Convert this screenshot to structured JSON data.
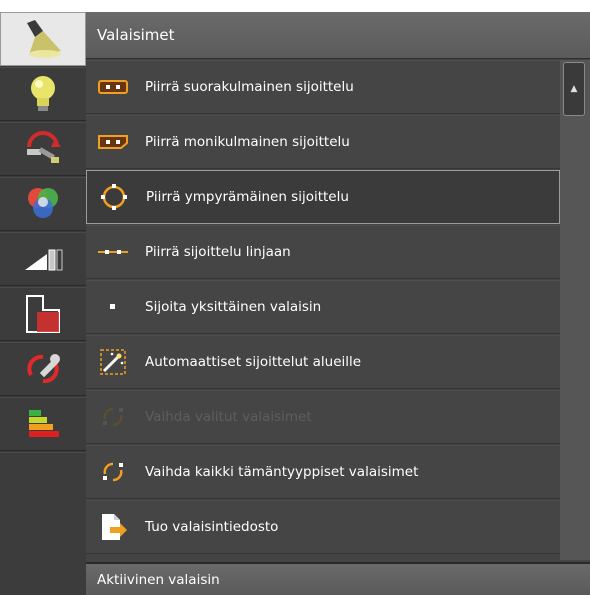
{
  "panel": {
    "title": "Valaisimet",
    "footer_title": "Aktiivinen valaisin"
  },
  "toolbar": {
    "tools": [
      {
        "name": "spotlight-icon",
        "active": true
      },
      {
        "name": "light-bulb-icon"
      },
      {
        "name": "lamp-adjust-icon"
      },
      {
        "name": "color-mix-icon"
      },
      {
        "name": "ramp-icon"
      },
      {
        "name": "room-area-icon"
      },
      {
        "name": "replace-tools-icon"
      },
      {
        "name": "energy-class-icon"
      }
    ]
  },
  "items": [
    {
      "label": "Piirrä suorakulmainen sijoittelu",
      "icon": "rectangular-placement-icon"
    },
    {
      "label": "Piirrä monikulmainen sijoittelu",
      "icon": "polygonal-placement-icon"
    },
    {
      "label": "Piirrä ympyrämäinen sijoittelu",
      "icon": "circular-placement-icon",
      "selected": true
    },
    {
      "label": "Piirrä sijoittelu linjaan",
      "icon": "line-placement-icon"
    },
    {
      "label": "Sijoita yksittäinen valaisin",
      "icon": "single-placement-icon"
    },
    {
      "label": "Automaattiset sijoittelut alueille",
      "icon": "auto-placement-icon"
    },
    {
      "label": "Vaihda valitut valaisimet",
      "icon": "replace-selected-icon",
      "disabled": true
    },
    {
      "label": "Vaihda kaikki tämäntyyppiset valaisimet",
      "icon": "replace-all-icon"
    },
    {
      "label": "Tuo valaisintiedosto",
      "icon": "import-file-icon"
    }
  ],
  "scrollbar": {
    "up_glyph": "▲"
  },
  "colors": {
    "accent": "#f0a020",
    "selection_border": "#9c9c9c"
  }
}
